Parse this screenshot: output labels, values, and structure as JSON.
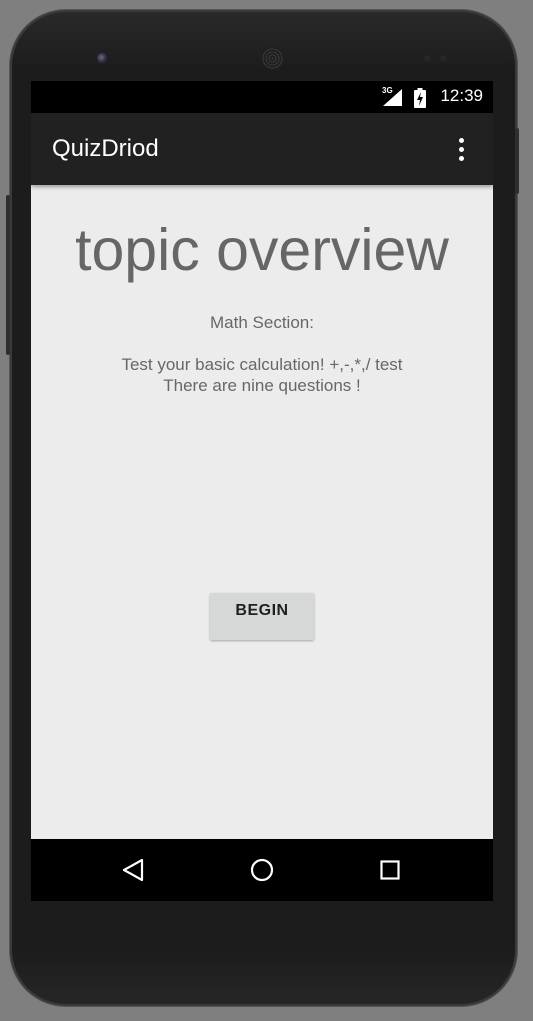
{
  "status_bar": {
    "network": "3G",
    "time": "12:39"
  },
  "app_bar": {
    "title": "QuizDriod"
  },
  "content": {
    "heading": "topic overview",
    "section": "Math Section:",
    "description_lines": [
      "Test your basic calculation! +,-,*,/ test",
      "There are nine questions !"
    ],
    "begin_label": "BEGIN"
  },
  "icons": {
    "signal": "signal-icon",
    "battery": "battery-charging-icon",
    "overflow": "overflow-menu-icon",
    "back": "back-icon",
    "home": "home-icon",
    "recents": "recents-icon"
  },
  "colors": {
    "app_bar": "#212121",
    "background": "#ececec",
    "button": "#d6d7d7",
    "text": "#676767"
  }
}
